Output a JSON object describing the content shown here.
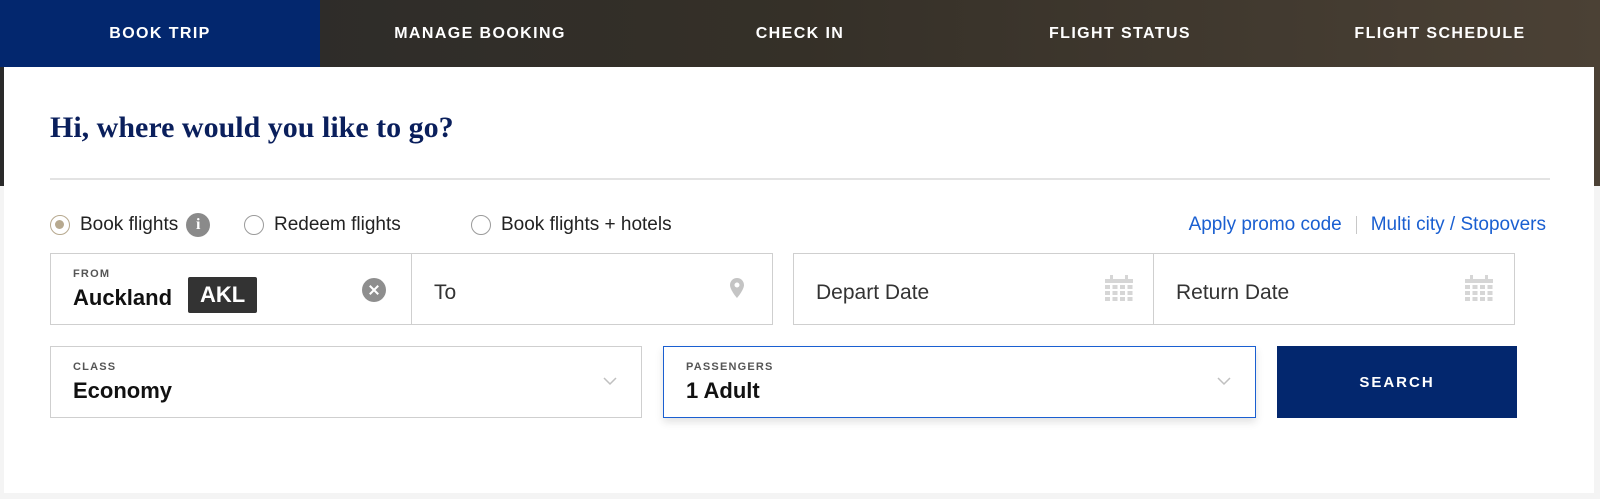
{
  "nav": {
    "tabs": [
      {
        "label": "BOOK TRIP",
        "active": true
      },
      {
        "label": "MANAGE BOOKING",
        "active": false
      },
      {
        "label": "CHECK IN",
        "active": false
      },
      {
        "label": "FLIGHT STATUS",
        "active": false
      },
      {
        "label": "FLIGHT SCHEDULE",
        "active": false
      }
    ]
  },
  "heading": "Hi, where would you like to go?",
  "trip_types": [
    {
      "label": "Book flights",
      "selected": true,
      "has_info": true,
      "info_glyph": "i"
    },
    {
      "label": "Redeem flights",
      "selected": false
    },
    {
      "label": "Book flights + hotels",
      "selected": false
    }
  ],
  "links": {
    "promo": "Apply promo code",
    "multi_city": "Multi city / Stopovers"
  },
  "from": {
    "label": "FROM",
    "city": "Auckland",
    "code": "AKL"
  },
  "to": {
    "placeholder": "To"
  },
  "depart": {
    "placeholder": "Depart Date"
  },
  "return": {
    "placeholder": "Return Date"
  },
  "class_field": {
    "label": "CLASS",
    "value": "Economy"
  },
  "passengers": {
    "label": "PASSENGERS",
    "value": "1 Adult"
  },
  "search_label": "SEARCH",
  "colors": {
    "brand_navy": "#03276e",
    "heading": "#0a1f5c",
    "link": "#1a5fd1",
    "radio_selected": "#b7a98f",
    "focus_border": "#1a5fd1"
  },
  "icons": {
    "info": "info-icon",
    "clear": "clear-icon",
    "location": "location-pin-icon",
    "calendar": "calendar-icon",
    "dropdown": "chevron-down-icon"
  }
}
